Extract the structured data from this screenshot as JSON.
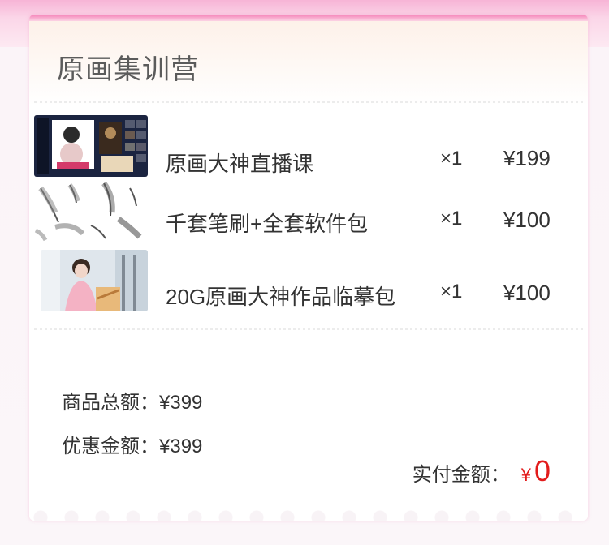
{
  "order": {
    "title": "原画集训营",
    "items": [
      {
        "name": "原画大神直播课",
        "qty": "×1",
        "price": "¥199",
        "thumb_icon": "live-course-thumbnail"
      },
      {
        "name": "千套笔刷+全套软件包",
        "qty": "×1",
        "price": "¥100",
        "thumb_icon": "feather-brush-thumbnail"
      },
      {
        "name": "20G原画大神作品临摹包",
        "qty": "×1",
        "price": "¥100",
        "thumb_icon": "artwork-pack-thumbnail"
      }
    ],
    "summary": {
      "subtotal_label": "商品总额：",
      "subtotal_value": "¥399",
      "discount_label": "优惠金额：",
      "discount_value": "¥399",
      "paid_label": "实付金额：",
      "paid_currency": "¥",
      "paid_value": "0"
    },
    "colors": {
      "accent_pink": "#f582b8",
      "pay_red": "#e21b1b"
    }
  }
}
